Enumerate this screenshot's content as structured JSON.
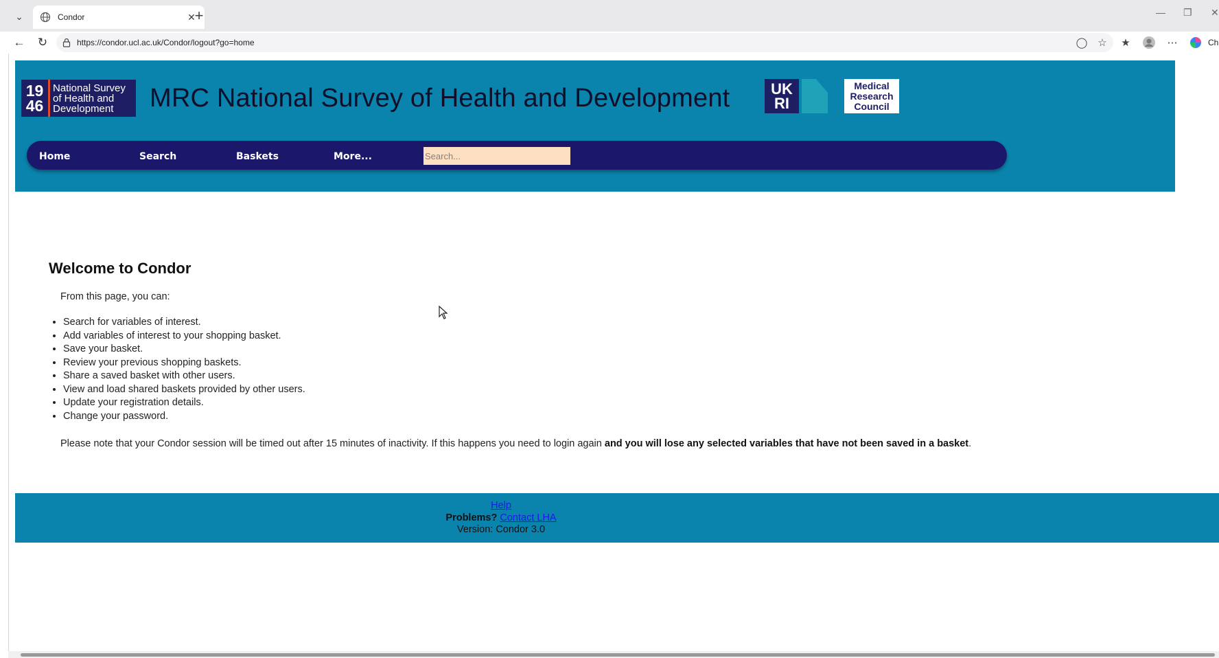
{
  "browser": {
    "tab_title": "Condor",
    "url": "https://condor.ucl.ac.uk/Condor/logout?go=home",
    "copilot_label": "Cha"
  },
  "header": {
    "logo_year_top": "19",
    "logo_year_bottom": "46",
    "logo_line1": "National Survey",
    "logo_line2": "of Health and",
    "logo_line3": "Development",
    "site_title": "MRC National Survey of Health and Development",
    "ukri_line1": "UK",
    "ukri_line2": "RI",
    "mrc_line1": "Medical",
    "mrc_line2": "Research",
    "mrc_line3": "Council"
  },
  "nav": {
    "home": "Home",
    "search": "Search",
    "baskets": "Baskets",
    "more": "More...",
    "search_placeholder": "Search..."
  },
  "main": {
    "heading": "Welcome to Condor",
    "intro": "From this page, you can:",
    "features": [
      "Search for variables of interest.",
      "Add variables of interest to your shopping basket.",
      "Save your basket.",
      "Review your previous shopping baskets.",
      "Share a saved basket with other users.",
      "View and load shared baskets provided by other users.",
      "Update your registration details.",
      "Change your password."
    ],
    "note_plain": "Please note that your Condor session will be timed out after 15 minutes of inactivity. If this happens you need to login again ",
    "note_bold": "and you will lose any selected variables that have not been saved in a basket",
    "note_end": "."
  },
  "footer": {
    "help_link": "Help",
    "problems_label": "Problems?",
    "contact_link": "Contact LHA",
    "version": "Version: Condor 3.0"
  },
  "colors": {
    "header_bg": "#0a84ad",
    "navbar_bg": "#1b176b",
    "search_bg": "#fde0c2"
  }
}
